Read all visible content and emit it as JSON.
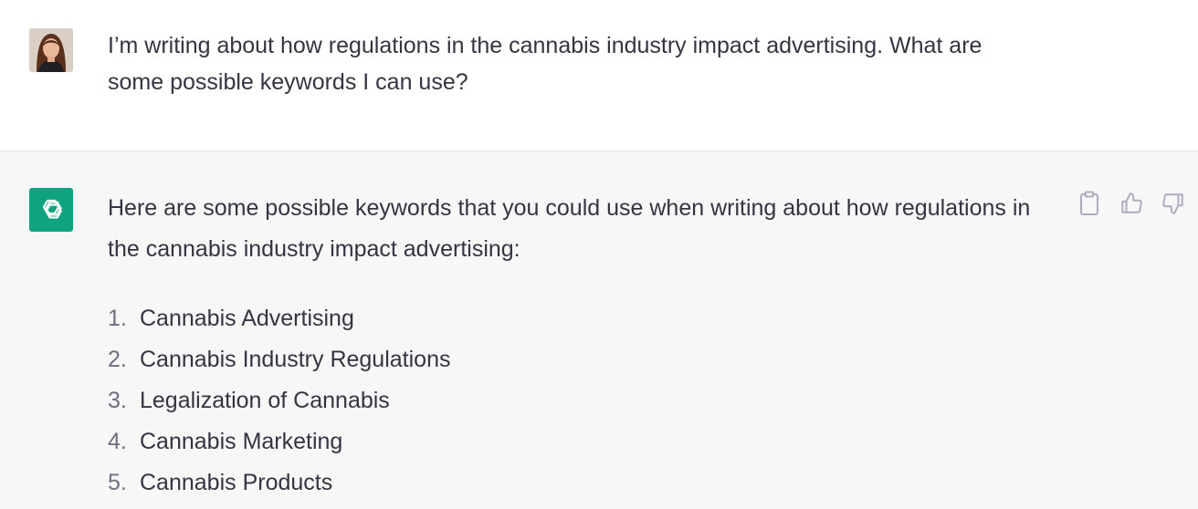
{
  "user_message": {
    "text": "I’m writing about how regulations in the cannabis industry impact advertising. What are some possible keywords I can use?"
  },
  "assistant_message": {
    "intro": "Here are some possible keywords that you could use when writing about how regulations in the cannabis industry impact advertising:",
    "keywords": [
      {
        "num": "1.",
        "text": "Cannabis Advertising"
      },
      {
        "num": "2.",
        "text": "Cannabis Industry Regulations"
      },
      {
        "num": "3.",
        "text": "Legalization of Cannabis"
      },
      {
        "num": "4.",
        "text": "Cannabis Marketing"
      },
      {
        "num": "5.",
        "text": "Cannabis Products"
      }
    ]
  },
  "actions": {
    "copy_icon": "clipboard-icon",
    "like_icon": "thumbs-up-icon",
    "dislike_icon": "thumbs-down-icon"
  },
  "colors": {
    "brand": "#10a37f",
    "text": "#343541",
    "muted": "#6e6e80",
    "assistant_bg": "#f7f7f8"
  }
}
